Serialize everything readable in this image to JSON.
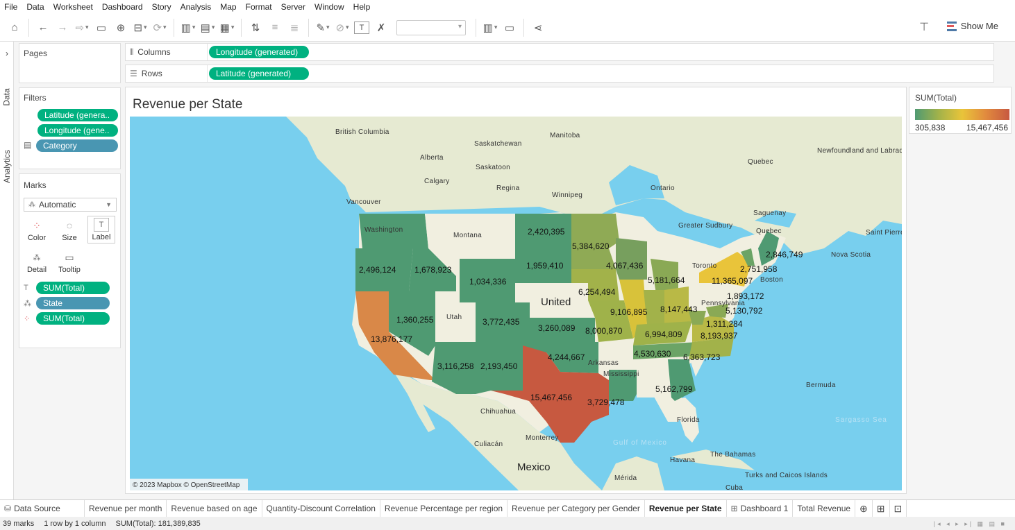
{
  "menu": [
    "File",
    "Data",
    "Worksheet",
    "Dashboard",
    "Story",
    "Analysis",
    "Map",
    "Format",
    "Server",
    "Window",
    "Help"
  ],
  "toolbar": {
    "show_me": "Show Me"
  },
  "side_tabs": {
    "data": "Data",
    "analytics": "Analytics"
  },
  "pages": {
    "title": "Pages"
  },
  "filters": {
    "title": "Filters",
    "items": [
      "Latitude (genera..",
      "Longitude (gene..",
      "Category"
    ]
  },
  "marks": {
    "title": "Marks",
    "type": "Automatic",
    "buttons": [
      "Color",
      "Size",
      "Label",
      "Detail",
      "Tooltip"
    ],
    "fields": [
      "SUM(Total)",
      "State",
      "SUM(Total)"
    ]
  },
  "shelves": {
    "columns_label": "Columns",
    "columns_pill": "Longitude (generated)",
    "rows_label": "Rows",
    "rows_pill": "Latitude (generated)"
  },
  "view": {
    "title": "Revenue per State",
    "attribution": "© 2023 Mapbox © OpenStreetMap"
  },
  "legend": {
    "title": "SUM(Total)",
    "min": "305,838",
    "max": "15,467,456",
    "colors": [
      "#4f9a72",
      "#a2b24a",
      "#e9c43a",
      "#e18a3e",
      "#c75940"
    ]
  },
  "map": {
    "country": "United",
    "country2": "Mexico",
    "places": [
      "British Columbia",
      "Alberta",
      "Saskatchewan",
      "Manitoba",
      "Saskatoon",
      "Calgary",
      "Regina",
      "Winnipeg",
      "Vancouver",
      "Ontario",
      "Quebec",
      "Newfoundland and Labrador",
      "Saguenay",
      "Quebec",
      "Greater Sudbury",
      "Saint Pierre and Miquelon",
      "Nova Scotia",
      "Toronto",
      "Boston",
      "Washington",
      "Montana",
      "Utah",
      "Arkansas",
      "Mississippi",
      "Florida",
      "Bermuda",
      "Chihuahua",
      "Culiacán",
      "Monterrey",
      "Havana",
      "The Bahamas",
      "Turks and Caicos Islands",
      "Mérida",
      "Cuba",
      "Pennsylvania"
    ],
    "oceans": [
      "Gulf of Mexico",
      "Sargasso Sea"
    ],
    "values": [
      "2,496,124",
      "1,678,923",
      "2,420,395",
      "5,384,620",
      "1,959,410",
      "4,067,436",
      "1,034,336",
      "6,254,494",
      "5,181,664",
      "2,846,749",
      "2,751,958",
      "11,365,097",
      "1,893,172",
      "5,130,792",
      "1,360,255",
      "3,772,435",
      "3,260,089",
      "9,106,895",
      "8,147,443",
      "13,876,177",
      "8,000,870",
      "6,994,809",
      "8,193,937",
      "1,311,284",
      "4,244,667",
      "4,530,630",
      "6,363,723",
      "3,116,258",
      "2,193,450",
      "15,467,456",
      "3,729,478",
      "5,162,799"
    ]
  },
  "sheet_tabs": [
    "Data Source",
    "Revenue per month",
    "Revenue based on age",
    "Quantity-Discount Correlation",
    "Revenue Percentage per region",
    "Revenue per Category per Gender",
    "Revenue per State",
    "Dashboard 1",
    "Total Revenue"
  ],
  "status": {
    "marks": "39 marks",
    "rows": "1 row by 1 column",
    "sum": "SUM(Total): 181,389,835"
  }
}
